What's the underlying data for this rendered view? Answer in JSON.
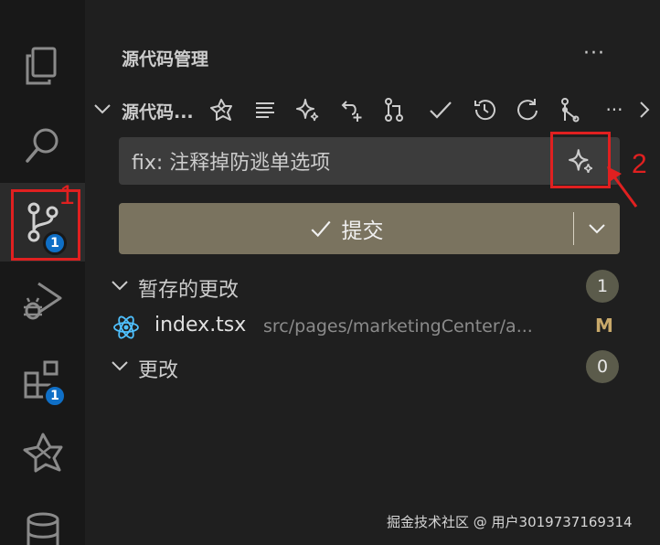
{
  "activity_bar": {
    "items": [
      {
        "name": "explorer",
        "icon": "files-icon"
      },
      {
        "name": "search",
        "icon": "search-icon"
      },
      {
        "name": "source-control",
        "icon": "source-control-icon",
        "badge": "1"
      },
      {
        "name": "run-debug",
        "icon": "debug-icon"
      },
      {
        "name": "extensions",
        "icon": "extensions-icon",
        "badge": "1"
      },
      {
        "name": "codegeex",
        "icon": "ai-logo-icon"
      },
      {
        "name": "database",
        "icon": "database-icon"
      }
    ],
    "source_control_badge": "1",
    "extensions_badge": "1"
  },
  "sidebar": {
    "title": "源代码管理",
    "more": "···"
  },
  "section": {
    "title": "源代码...",
    "more": "···",
    "toolbar_icons": [
      "ai-logo-icon",
      "list-icon",
      "sparkle-icon",
      "undo-plus-icon",
      "branch-icon",
      "check-icon",
      "history-icon",
      "refresh-icon",
      "graph-icon",
      "more-icon",
      "chevron-right-icon"
    ]
  },
  "commit": {
    "message_value": "fix: 注释掉防逃单选项",
    "button_label": "提交",
    "button_color": "#7a735f"
  },
  "staged": {
    "label": "暂存的更改",
    "count": "1",
    "files": [
      {
        "name": "index.tsx",
        "path": "src/pages/marketingCenter/a...",
        "status": "M"
      }
    ]
  },
  "changes": {
    "label": "更改",
    "count": "0"
  },
  "annotations": {
    "first": "1",
    "second": "2",
    "color": "#e02020"
  },
  "watermark": "掘金技术社区 @ 用户3019737169314"
}
